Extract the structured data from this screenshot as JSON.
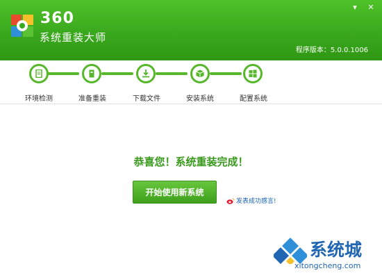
{
  "window": {
    "minimize_glyph": "▾",
    "close_glyph": "✕"
  },
  "brand": {
    "number": "360",
    "name": "系统重装大师"
  },
  "version": "程序版本：5.0.0.1006",
  "steps": [
    {
      "label": "环境检测",
      "icon": "document-icon"
    },
    {
      "label": "准备重装",
      "icon": "clipboard-icon"
    },
    {
      "label": "下载文件",
      "icon": "download-icon"
    },
    {
      "label": "安装系统",
      "icon": "package-icon"
    },
    {
      "label": "配置系统",
      "icon": "windows-icon"
    }
  ],
  "main": {
    "message": "恭喜您！系统重装完成！",
    "start_button": "开始使用新系统",
    "feedback_link": "发表成功感言!"
  },
  "watermark": {
    "text": "系统城",
    "url": "xitongcheng.com"
  },
  "colors": {
    "header_green": "#3aa81d",
    "accent_green": "#56b72b",
    "message_green": "#3a9a1e",
    "link_blue": "#1a63b8"
  }
}
